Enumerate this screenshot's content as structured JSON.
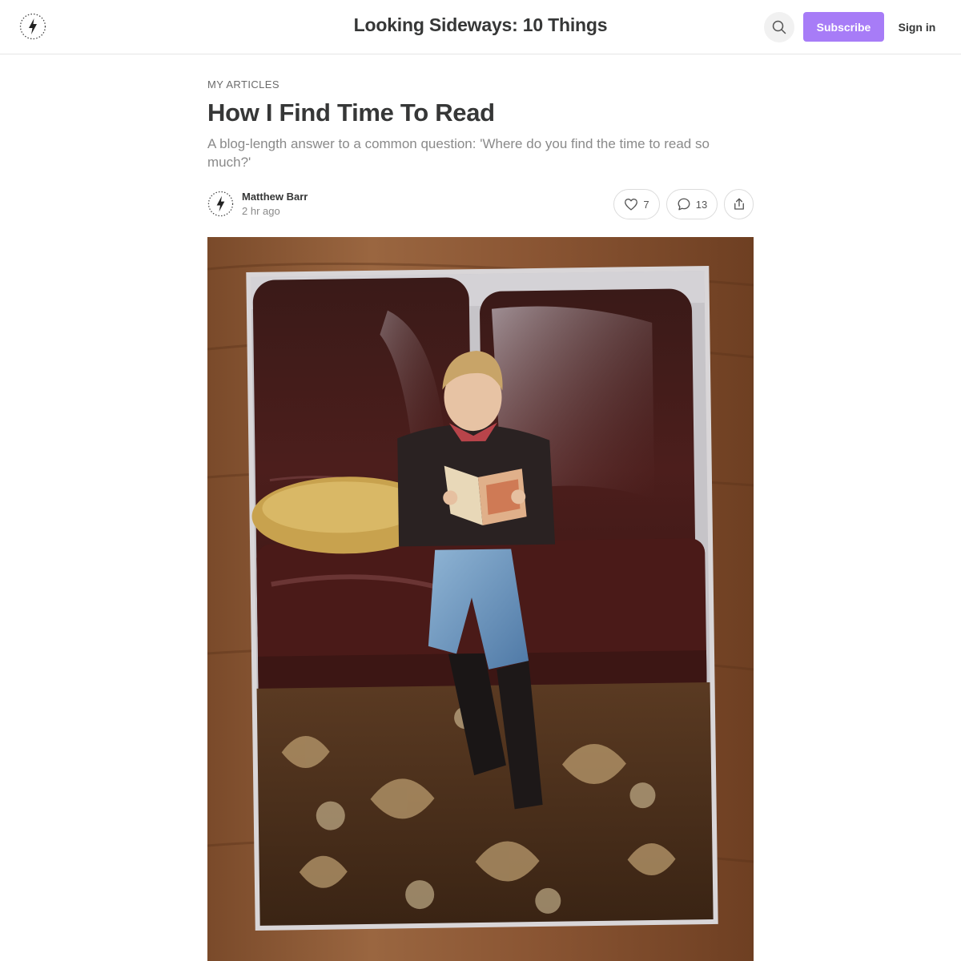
{
  "header": {
    "publication_title": "Looking Sideways: 10 Things",
    "subscribe_label": "Subscribe",
    "signin_label": "Sign in",
    "accent_color": "#a77cf7"
  },
  "post": {
    "section": "MY ARTICLES",
    "title": "How I Find Time To Read",
    "subtitle": "A blog-length answer to a common question: 'Where do you find the time to read so much?'",
    "author": "Matthew Barr",
    "date": "2 hr ago",
    "likes": "7",
    "comments": "13"
  },
  "icons": {
    "logo": "lightning-bolt-icon",
    "search": "search-icon",
    "like": "heart-icon",
    "comment": "comment-bubble-icon",
    "share": "share-icon"
  }
}
